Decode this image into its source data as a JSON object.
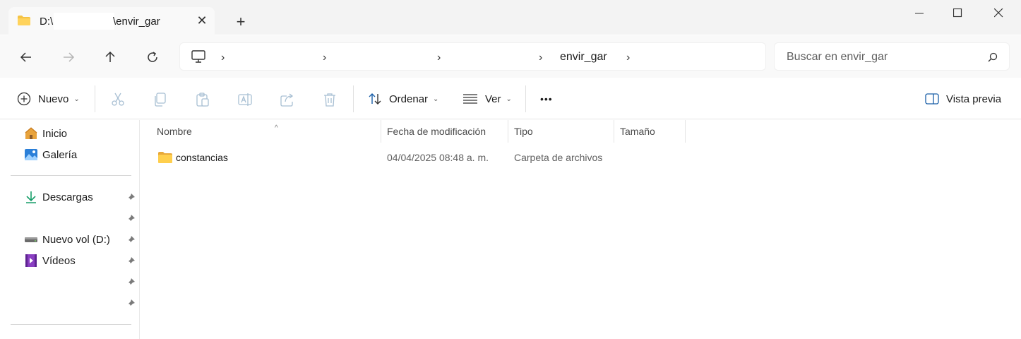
{
  "window": {
    "tab_title_prefix": "D:\\",
    "tab_title_suffix": "\\envir_gar",
    "close_tab_glyph": "✕",
    "new_tab_glyph": "+"
  },
  "address": {
    "breadcrumb_last": "envir_gar",
    "chevron": "›"
  },
  "search": {
    "placeholder": "Buscar en envir_gar"
  },
  "toolbar": {
    "new_label": "Nuevo",
    "sort_label": "Ordenar",
    "view_label": "Ver",
    "more_label": "•••",
    "preview_label": "Vista previa",
    "caret": "⌄"
  },
  "sidebar": {
    "items": [
      {
        "label": "Inicio",
        "icon": "home-icon"
      },
      {
        "label": "Galería",
        "icon": "gallery-icon"
      },
      {
        "label": "Descargas",
        "icon": "download-icon",
        "pinned": true
      },
      {
        "label": "Nuevo vol (D:)",
        "icon": "drive-icon",
        "pinned": true
      },
      {
        "label": "Vídeos",
        "icon": "videos-icon",
        "pinned": true
      }
    ]
  },
  "columns": {
    "name": "Nombre",
    "modified": "Fecha de modificación",
    "type": "Tipo",
    "size": "Tamaño",
    "sort_indicator": "^"
  },
  "rows": [
    {
      "name": "constancias",
      "modified": "04/04/2025 08:48 a. m.",
      "type": "Carpeta de archivos",
      "size": ""
    }
  ],
  "colors": {
    "accent": "#0067c0",
    "folder": "#f5c344",
    "titlebar": "#f3f3f3"
  }
}
